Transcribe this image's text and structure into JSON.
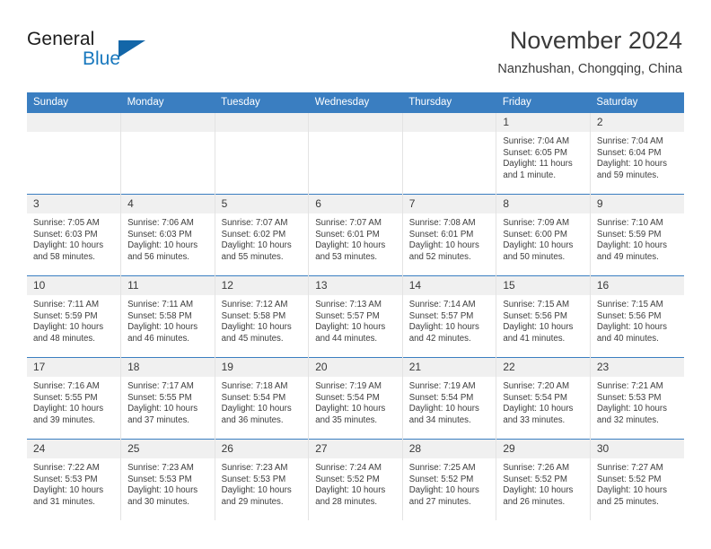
{
  "brand": {
    "line1": "General",
    "line2": "Blue",
    "mark": "triangle-logo"
  },
  "header": {
    "title": "November 2024",
    "subtitle": "Nanzhushan, Chongqing, China"
  },
  "weekday_headers": [
    "Sunday",
    "Monday",
    "Tuesday",
    "Wednesday",
    "Thursday",
    "Friday",
    "Saturday"
  ],
  "colors": {
    "header_blue": "#3a7ec1",
    "brand_blue": "#1878be",
    "logo_blue": "#1366a8",
    "daynum_band": "#f0f0f0",
    "text": "#3d3d3d"
  },
  "weeks": [
    [
      {
        "day": "",
        "sunrise": "",
        "sunset": "",
        "daylight1": "",
        "daylight2": ""
      },
      {
        "day": "",
        "sunrise": "",
        "sunset": "",
        "daylight1": "",
        "daylight2": ""
      },
      {
        "day": "",
        "sunrise": "",
        "sunset": "",
        "daylight1": "",
        "daylight2": ""
      },
      {
        "day": "",
        "sunrise": "",
        "sunset": "",
        "daylight1": "",
        "daylight2": ""
      },
      {
        "day": "",
        "sunrise": "",
        "sunset": "",
        "daylight1": "",
        "daylight2": ""
      },
      {
        "day": "1",
        "sunrise": "Sunrise: 7:04 AM",
        "sunset": "Sunset: 6:05 PM",
        "daylight1": "Daylight: 11 hours",
        "daylight2": "and 1 minute."
      },
      {
        "day": "2",
        "sunrise": "Sunrise: 7:04 AM",
        "sunset": "Sunset: 6:04 PM",
        "daylight1": "Daylight: 10 hours",
        "daylight2": "and 59 minutes."
      }
    ],
    [
      {
        "day": "3",
        "sunrise": "Sunrise: 7:05 AM",
        "sunset": "Sunset: 6:03 PM",
        "daylight1": "Daylight: 10 hours",
        "daylight2": "and 58 minutes."
      },
      {
        "day": "4",
        "sunrise": "Sunrise: 7:06 AM",
        "sunset": "Sunset: 6:03 PM",
        "daylight1": "Daylight: 10 hours",
        "daylight2": "and 56 minutes."
      },
      {
        "day": "5",
        "sunrise": "Sunrise: 7:07 AM",
        "sunset": "Sunset: 6:02 PM",
        "daylight1": "Daylight: 10 hours",
        "daylight2": "and 55 minutes."
      },
      {
        "day": "6",
        "sunrise": "Sunrise: 7:07 AM",
        "sunset": "Sunset: 6:01 PM",
        "daylight1": "Daylight: 10 hours",
        "daylight2": "and 53 minutes."
      },
      {
        "day": "7",
        "sunrise": "Sunrise: 7:08 AM",
        "sunset": "Sunset: 6:01 PM",
        "daylight1": "Daylight: 10 hours",
        "daylight2": "and 52 minutes."
      },
      {
        "day": "8",
        "sunrise": "Sunrise: 7:09 AM",
        "sunset": "Sunset: 6:00 PM",
        "daylight1": "Daylight: 10 hours",
        "daylight2": "and 50 minutes."
      },
      {
        "day": "9",
        "sunrise": "Sunrise: 7:10 AM",
        "sunset": "Sunset: 5:59 PM",
        "daylight1": "Daylight: 10 hours",
        "daylight2": "and 49 minutes."
      }
    ],
    [
      {
        "day": "10",
        "sunrise": "Sunrise: 7:11 AM",
        "sunset": "Sunset: 5:59 PM",
        "daylight1": "Daylight: 10 hours",
        "daylight2": "and 48 minutes."
      },
      {
        "day": "11",
        "sunrise": "Sunrise: 7:11 AM",
        "sunset": "Sunset: 5:58 PM",
        "daylight1": "Daylight: 10 hours",
        "daylight2": "and 46 minutes."
      },
      {
        "day": "12",
        "sunrise": "Sunrise: 7:12 AM",
        "sunset": "Sunset: 5:58 PM",
        "daylight1": "Daylight: 10 hours",
        "daylight2": "and 45 minutes."
      },
      {
        "day": "13",
        "sunrise": "Sunrise: 7:13 AM",
        "sunset": "Sunset: 5:57 PM",
        "daylight1": "Daylight: 10 hours",
        "daylight2": "and 44 minutes."
      },
      {
        "day": "14",
        "sunrise": "Sunrise: 7:14 AM",
        "sunset": "Sunset: 5:57 PM",
        "daylight1": "Daylight: 10 hours",
        "daylight2": "and 42 minutes."
      },
      {
        "day": "15",
        "sunrise": "Sunrise: 7:15 AM",
        "sunset": "Sunset: 5:56 PM",
        "daylight1": "Daylight: 10 hours",
        "daylight2": "and 41 minutes."
      },
      {
        "day": "16",
        "sunrise": "Sunrise: 7:15 AM",
        "sunset": "Sunset: 5:56 PM",
        "daylight1": "Daylight: 10 hours",
        "daylight2": "and 40 minutes."
      }
    ],
    [
      {
        "day": "17",
        "sunrise": "Sunrise: 7:16 AM",
        "sunset": "Sunset: 5:55 PM",
        "daylight1": "Daylight: 10 hours",
        "daylight2": "and 39 minutes."
      },
      {
        "day": "18",
        "sunrise": "Sunrise: 7:17 AM",
        "sunset": "Sunset: 5:55 PM",
        "daylight1": "Daylight: 10 hours",
        "daylight2": "and 37 minutes."
      },
      {
        "day": "19",
        "sunrise": "Sunrise: 7:18 AM",
        "sunset": "Sunset: 5:54 PM",
        "daylight1": "Daylight: 10 hours",
        "daylight2": "and 36 minutes."
      },
      {
        "day": "20",
        "sunrise": "Sunrise: 7:19 AM",
        "sunset": "Sunset: 5:54 PM",
        "daylight1": "Daylight: 10 hours",
        "daylight2": "and 35 minutes."
      },
      {
        "day": "21",
        "sunrise": "Sunrise: 7:19 AM",
        "sunset": "Sunset: 5:54 PM",
        "daylight1": "Daylight: 10 hours",
        "daylight2": "and 34 minutes."
      },
      {
        "day": "22",
        "sunrise": "Sunrise: 7:20 AM",
        "sunset": "Sunset: 5:54 PM",
        "daylight1": "Daylight: 10 hours",
        "daylight2": "and 33 minutes."
      },
      {
        "day": "23",
        "sunrise": "Sunrise: 7:21 AM",
        "sunset": "Sunset: 5:53 PM",
        "daylight1": "Daylight: 10 hours",
        "daylight2": "and 32 minutes."
      }
    ],
    [
      {
        "day": "24",
        "sunrise": "Sunrise: 7:22 AM",
        "sunset": "Sunset: 5:53 PM",
        "daylight1": "Daylight: 10 hours",
        "daylight2": "and 31 minutes."
      },
      {
        "day": "25",
        "sunrise": "Sunrise: 7:23 AM",
        "sunset": "Sunset: 5:53 PM",
        "daylight1": "Daylight: 10 hours",
        "daylight2": "and 30 minutes."
      },
      {
        "day": "26",
        "sunrise": "Sunrise: 7:23 AM",
        "sunset": "Sunset: 5:53 PM",
        "daylight1": "Daylight: 10 hours",
        "daylight2": "and 29 minutes."
      },
      {
        "day": "27",
        "sunrise": "Sunrise: 7:24 AM",
        "sunset": "Sunset: 5:52 PM",
        "daylight1": "Daylight: 10 hours",
        "daylight2": "and 28 minutes."
      },
      {
        "day": "28",
        "sunrise": "Sunrise: 7:25 AM",
        "sunset": "Sunset: 5:52 PM",
        "daylight1": "Daylight: 10 hours",
        "daylight2": "and 27 minutes."
      },
      {
        "day": "29",
        "sunrise": "Sunrise: 7:26 AM",
        "sunset": "Sunset: 5:52 PM",
        "daylight1": "Daylight: 10 hours",
        "daylight2": "and 26 minutes."
      },
      {
        "day": "30",
        "sunrise": "Sunrise: 7:27 AM",
        "sunset": "Sunset: 5:52 PM",
        "daylight1": "Daylight: 10 hours",
        "daylight2": "and 25 minutes."
      }
    ]
  ]
}
